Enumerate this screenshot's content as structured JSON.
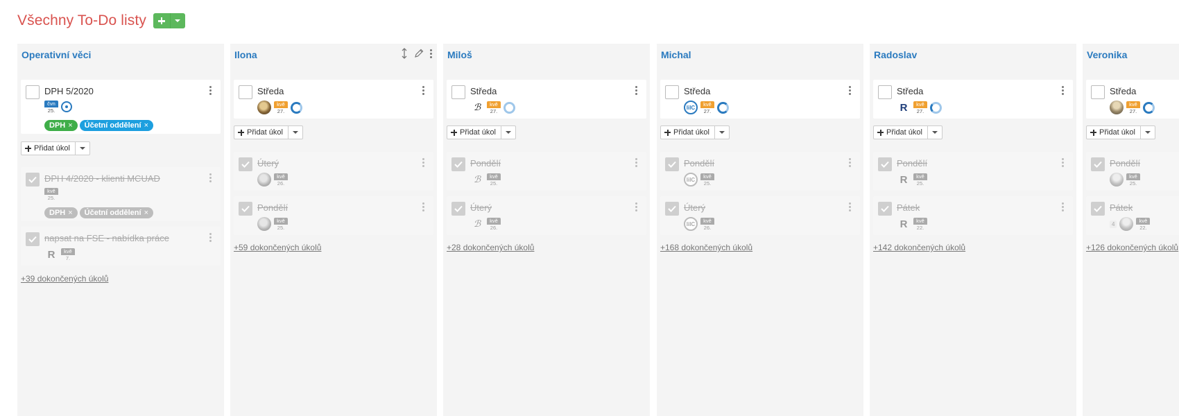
{
  "page": {
    "title": "Všechny To-Do listy"
  },
  "add_task_label": "Přidat úkol",
  "columns": [
    {
      "title": "Operativní věci",
      "tasks": [
        {
          "title": "DPH 5/2020",
          "done": false,
          "date": {
            "month": "čvn",
            "day": "25."
          },
          "tags": [
            "DPH",
            "Účetní oddělení"
          ]
        }
      ],
      "done_tasks": [
        {
          "title": "DPH 4/2020 - klienti MCUAD",
          "date": {
            "month": "kvě",
            "day": "25."
          },
          "tags": [
            "DPH",
            "Účetní oddělení"
          ]
        },
        {
          "title": "napsat na FSE - nabídka práce",
          "avatar": "R",
          "date": {
            "month": "kvě",
            "day": "7."
          }
        }
      ],
      "more": "+39 dokončených úkolů"
    },
    {
      "title": "Ilona",
      "tasks": [
        {
          "title": "Středa",
          "date": {
            "month": "kvě",
            "day": "27."
          }
        }
      ],
      "done_tasks": [
        {
          "title": "Úterý",
          "date": {
            "month": "kvě",
            "day": "26."
          }
        },
        {
          "title": "Pondělí",
          "date": {
            "month": "kvě",
            "day": "25."
          }
        }
      ],
      "more": "+59 dokončených úkolů"
    },
    {
      "title": "Miloš",
      "tasks": [
        {
          "title": "Středa",
          "date": {
            "month": "kvě",
            "day": "27."
          }
        }
      ],
      "done_tasks": [
        {
          "title": "Pondělí",
          "date": {
            "month": "kvě",
            "day": "25."
          }
        },
        {
          "title": "Úterý",
          "date": {
            "month": "kvě",
            "day": "26."
          }
        }
      ],
      "more": "+28 dokončených úkolů"
    },
    {
      "title": "Michal",
      "tasks": [
        {
          "title": "Středa",
          "avatar": "lilC",
          "date": {
            "month": "kvě",
            "day": "27."
          }
        }
      ],
      "done_tasks": [
        {
          "title": "Pondělí",
          "avatar": "lilC",
          "date": {
            "month": "kvě",
            "day": "25."
          }
        },
        {
          "title": "Úterý",
          "avatar": "lilC",
          "date": {
            "month": "kvě",
            "day": "26."
          }
        }
      ],
      "more": "+168 dokončených úkolů"
    },
    {
      "title": "Radoslav",
      "tasks": [
        {
          "title": "Středa",
          "avatar": "R",
          "date": {
            "month": "kvě",
            "day": "27."
          }
        }
      ],
      "done_tasks": [
        {
          "title": "Pondělí",
          "avatar": "R",
          "date": {
            "month": "kvě",
            "day": "25."
          }
        },
        {
          "title": "Pátek",
          "avatar": "R",
          "date": {
            "month": "kvě",
            "day": "22."
          }
        }
      ],
      "more": "+142 dokončených úkolů"
    },
    {
      "title": "Veronika",
      "tasks": [
        {
          "title": "Středa",
          "date": {
            "month": "kvě",
            "day": "27."
          }
        }
      ],
      "done_tasks": [
        {
          "title": "Pondělí",
          "date": {
            "month": "kvě",
            "day": "25."
          }
        },
        {
          "title": "Pátek",
          "count": "4",
          "date": {
            "month": "kvě",
            "day": "22."
          }
        }
      ],
      "more": "+126 dokončených úkolů"
    }
  ]
}
